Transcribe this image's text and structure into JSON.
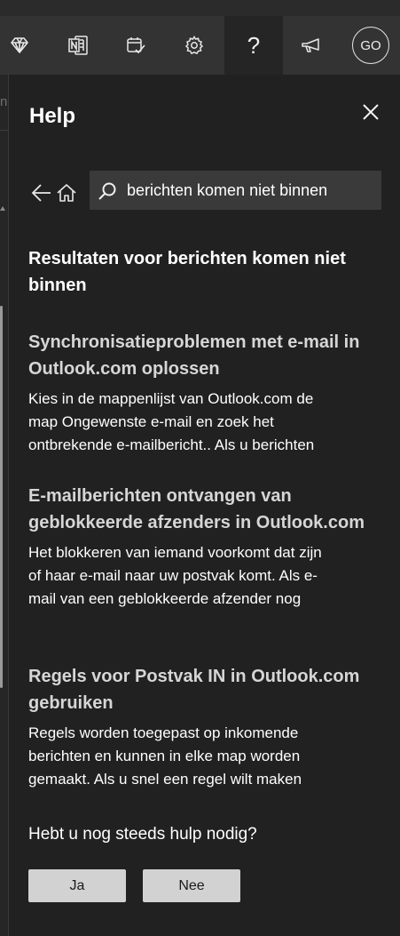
{
  "toolbar": {
    "icons": [
      "premium-diamond-icon",
      "onenote-icon",
      "calendar-check-icon",
      "settings-gear-icon",
      "help-question-icon",
      "feedback-megaphone-icon"
    ],
    "help_glyph": "?",
    "avatar_initials": "GO"
  },
  "left_edge": {
    "peek_char": "n"
  },
  "help": {
    "title": "Help",
    "search": {
      "value": "berichten komen niet binnen",
      "placeholder": ""
    },
    "results_heading": "Resultaten voor berichten komen niet binnen",
    "results": [
      {
        "title": "Synchronisatieproblemen met e-mail in Outlook.com oplossen",
        "snippet_lines": [
          "Kies in de mappenlijst van Outlook.com de",
          "map Ongewenste e-mail en zoek het",
          "ontbrekende e-mailbericht.. Als u berichten"
        ]
      },
      {
        "title": "E-mailberichten ontvangen van geblokkeerde afzenders in Outlook.com",
        "snippet_lines": [
          "Het blokkeren van iemand voorkomt dat zijn",
          "of haar e-mail naar uw postvak komt. Als e-",
          "mail van een geblokkeerde afzender nog"
        ]
      },
      {
        "title": "Regels voor Postvak IN in Outlook.com gebruiken",
        "snippet_lines": [
          "Regels worden toegepast op inkomende",
          "berichten en kunnen in elke map worden",
          "gemaakt. Als u snel een regel wilt maken"
        ]
      }
    ],
    "still_need_help": "Hebt u nog steeds hulp nodig?",
    "yes_label": "Ja",
    "no_label": "Nee"
  },
  "colors": {
    "panel_bg": "#212121",
    "toolbar_bg": "#333333",
    "active_tab_bg": "#252525",
    "search_bg": "#3a3a3a",
    "button_bg": "#d2d2d2",
    "result_title": "#d6d6d6"
  }
}
